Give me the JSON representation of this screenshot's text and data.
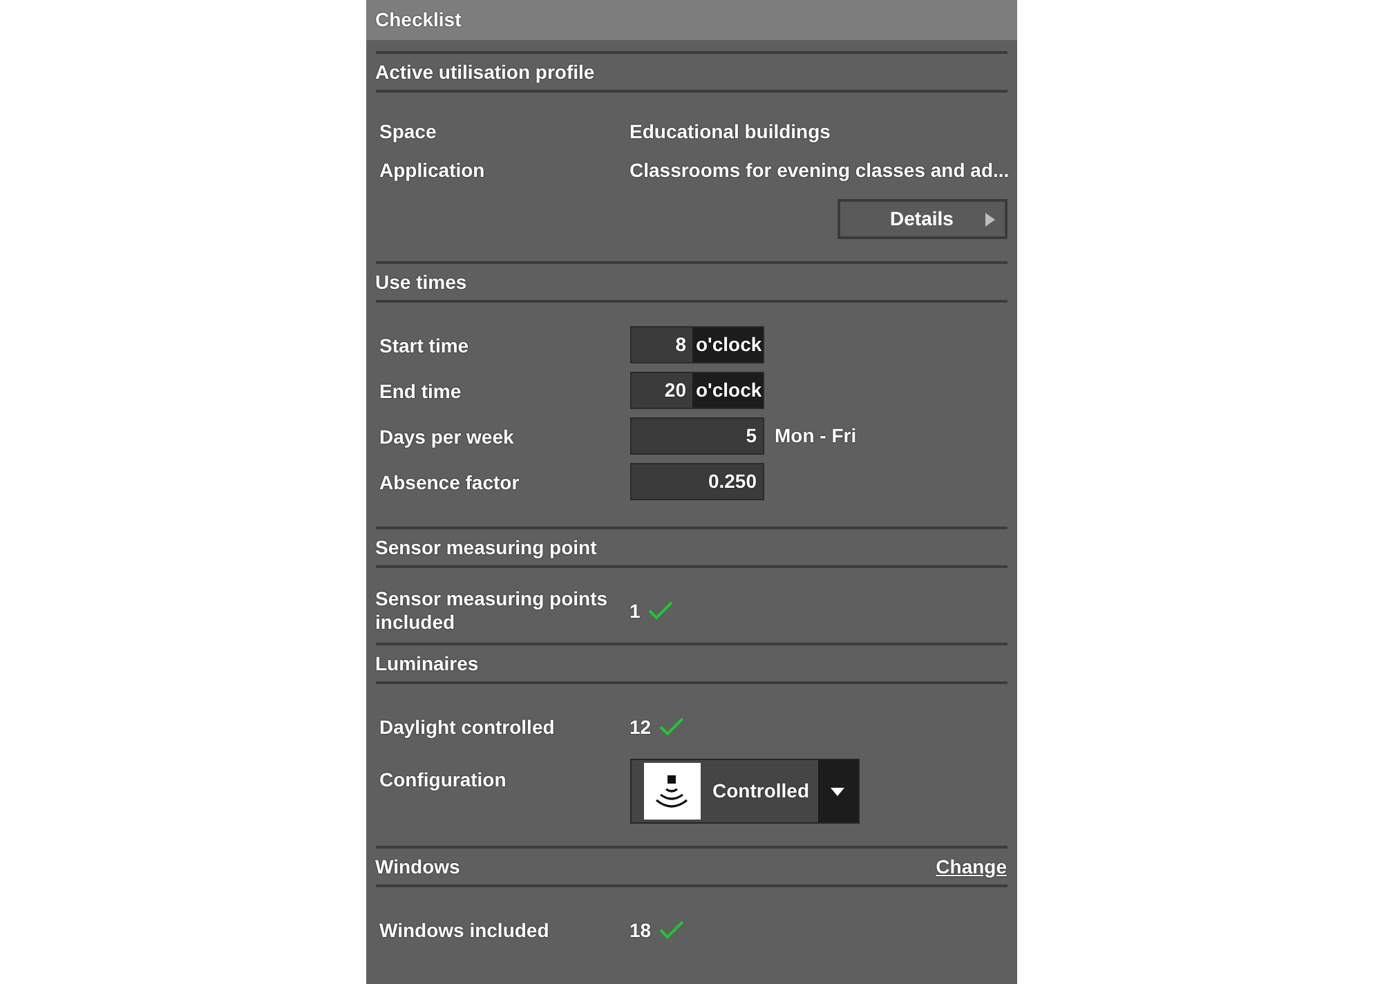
{
  "panel": {
    "title": "Checklist"
  },
  "sections": [
    {
      "title": "Active utilisation profile",
      "rows": [
        {
          "kind": "text",
          "label": "Space",
          "value": "Educational buildings"
        },
        {
          "kind": "text",
          "label": "Application",
          "value": "Classrooms for evening classes and ad..."
        },
        {
          "kind": "button",
          "label": "Details"
        }
      ]
    },
    {
      "title": "Use times",
      "rows": [
        {
          "kind": "time",
          "label": "Start time",
          "value": "8",
          "unit": "o'clock"
        },
        {
          "kind": "time",
          "label": "End time",
          "value": "20",
          "unit": "o'clock"
        },
        {
          "kind": "number",
          "label": "Days per week",
          "value": "5",
          "suffix": "Mon - Fri"
        },
        {
          "kind": "number",
          "label": "Absence factor",
          "value": "0.250"
        }
      ]
    },
    {
      "title": "Sensor measuring point",
      "rows": [
        {
          "kind": "check",
          "label": "Sensor measuring points included",
          "value": "1",
          "checked": true
        }
      ]
    },
    {
      "title": "Luminaires",
      "rows": [
        {
          "kind": "check",
          "label": "Daylight controlled",
          "value": "12",
          "checked": true
        },
        {
          "kind": "dropdown",
          "label": "Configuration",
          "value": "Controlled"
        }
      ]
    },
    {
      "title": "Windows",
      "link": "Change",
      "rows": [
        {
          "kind": "check",
          "label": "Windows included",
          "value": "18",
          "checked": true
        }
      ]
    }
  ]
}
